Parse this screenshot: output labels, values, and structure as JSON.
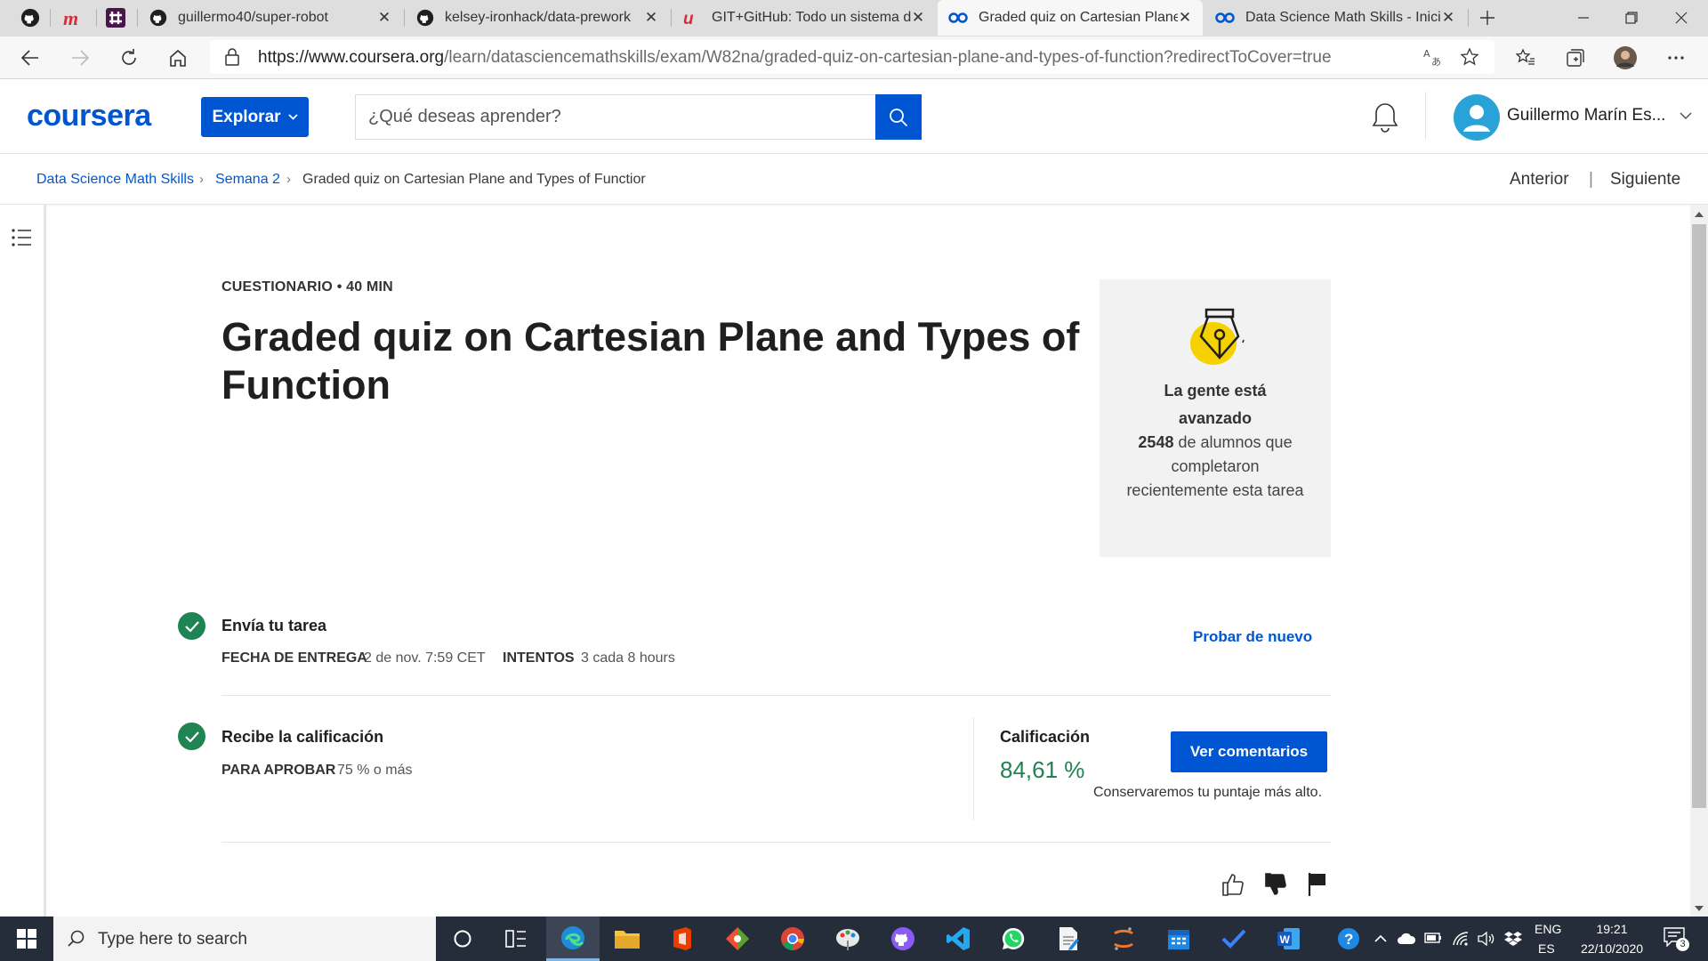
{
  "browser": {
    "tabs": [
      {
        "title": "guillermo40/super-robot"
      },
      {
        "title": "kelsey-ironhack/data-prework"
      },
      {
        "title": "GIT+GitHub: Todo un sistema de"
      },
      {
        "title": "Graded quiz on Cartesian Plane a"
      },
      {
        "title": "Data Science Math Skills - Inicio"
      }
    ],
    "url_host": "https://www.coursera.org",
    "url_path": "/learn/datasciencemathskills/exam/W82na/graded-quiz-on-cartesian-plane-and-types-of-function?redirectToCover=true"
  },
  "header": {
    "logo": "coursera",
    "explore_label": "Explorar",
    "search_placeholder": "¿Qué deseas aprender?",
    "user_name": "Guillermo Marín Es..."
  },
  "breadcrumb": {
    "course": "Data Science Math Skills",
    "week": "Semana 2",
    "current": "Graded quiz on Cartesian Plane and Types of Functior",
    "prev": "Anterior",
    "separator": "|",
    "next": "Siguiente"
  },
  "quiz": {
    "eyebrow": "CUESTIONARIO • 40 MIN",
    "title": "Graded quiz on Cartesian Plane and Types of Function"
  },
  "progress_card": {
    "title": "La gente está avanzado",
    "count": "2548",
    "text": "de alumnos que completaron recientemente esta tarea"
  },
  "submit": {
    "title": "Envía tu tarea",
    "due_key": "FECHA DE ENTREGA",
    "due_val": "2 de nov. 7:59 CET",
    "attempts_key": "INTENTOS",
    "attempts_val": "3 cada 8 hours",
    "retry_label": "Probar de nuevo"
  },
  "grade": {
    "title": "Recibe la calificación",
    "pass_key": "PARA APROBAR",
    "pass_val": "75 % o más",
    "label": "Calificación",
    "value": "84,61 %",
    "feedback_label": "Ver comentarios",
    "keep_note": "Conservaremos tu puntaje más alto."
  },
  "taskbar": {
    "search_placeholder": "Type here to search",
    "lang_top": "ENG",
    "lang_bottom": "ES",
    "time": "19:21",
    "date": "22/10/2020",
    "notifications": "3"
  },
  "colors": {
    "brand_blue": "#0056d2",
    "success_green": "#1f8354",
    "taskbar": "#252d3a"
  }
}
